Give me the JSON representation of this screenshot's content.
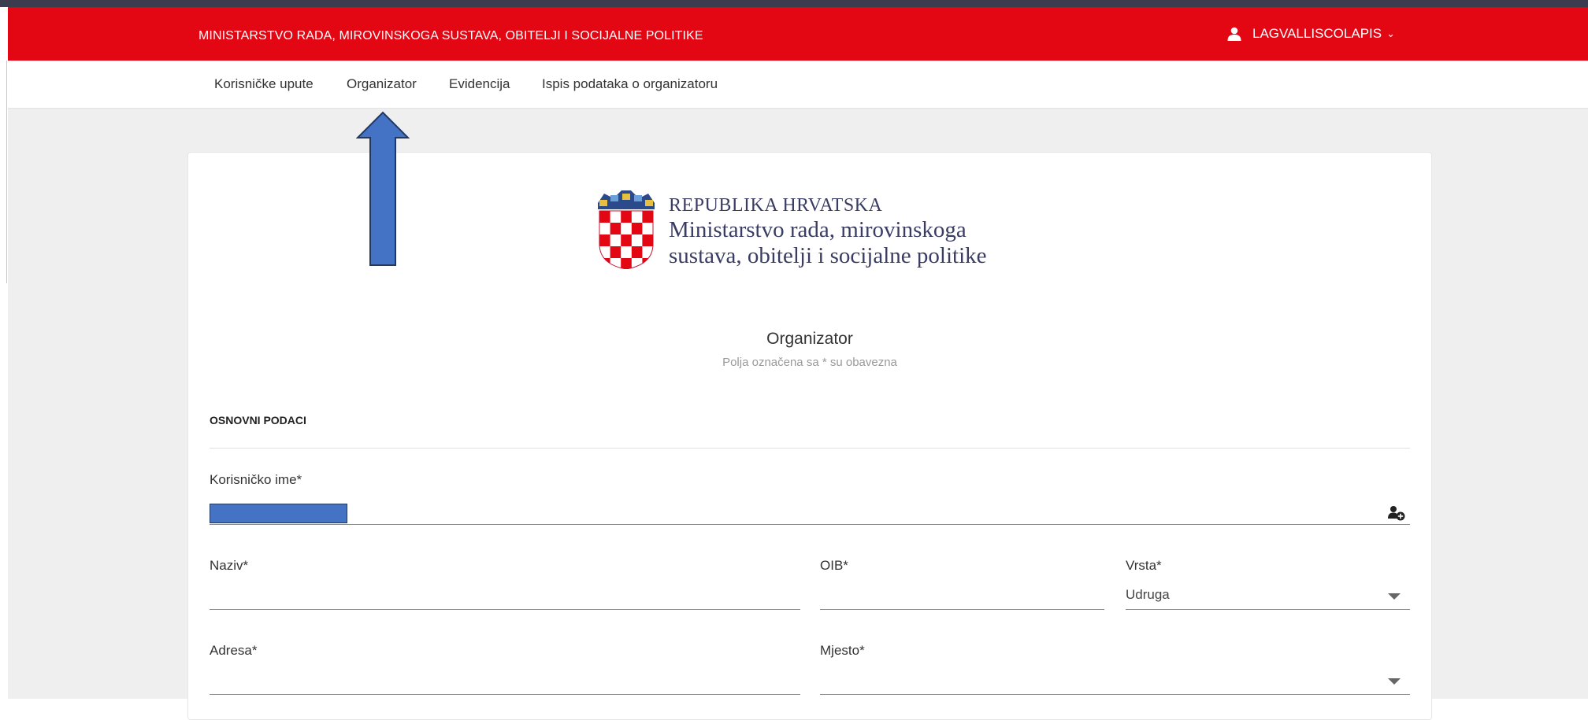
{
  "header": {
    "ministry": "MINISTARSTVO RADA, MIROVINSKOGA SUSTAVA, OBITELJI I SOCIJALNE POLITIKE",
    "username": "LAGVALLISCOLAPIS"
  },
  "nav": {
    "items": [
      "Korisničke upute",
      "Organizator",
      "Evidencija",
      "Ispis podataka o organizatoru"
    ]
  },
  "logo": {
    "line1": "REPUBLIKA HRVATSKA",
    "line2": "Ministarstvo rada, mirovinskoga",
    "line3": "sustava, obitelji i socijalne politike"
  },
  "form": {
    "title": "Organizator",
    "subtitle": "Polja označena sa * su obavezna",
    "section": "OSNOVNI PODACI",
    "korisnicko_ime": {
      "label": "Korisničko ime*",
      "value": ""
    },
    "naziv": {
      "label": "Naziv*",
      "value": ""
    },
    "oib": {
      "label": "OIB*",
      "value": ""
    },
    "vrsta": {
      "label": "Vrsta*",
      "value": "Udruga"
    },
    "adresa": {
      "label": "Adresa*",
      "value": ""
    },
    "mjesto": {
      "label": "Mjesto*",
      "value": ""
    }
  },
  "icons": {
    "user": "user-icon",
    "chevron": "chevron-down-icon",
    "user_add": "user-add-icon",
    "dropdown": "dropdown-caret-icon",
    "annotation": "up-arrow-annotation"
  },
  "colors": {
    "header": "#e30613",
    "annotation": "#4472c4"
  }
}
